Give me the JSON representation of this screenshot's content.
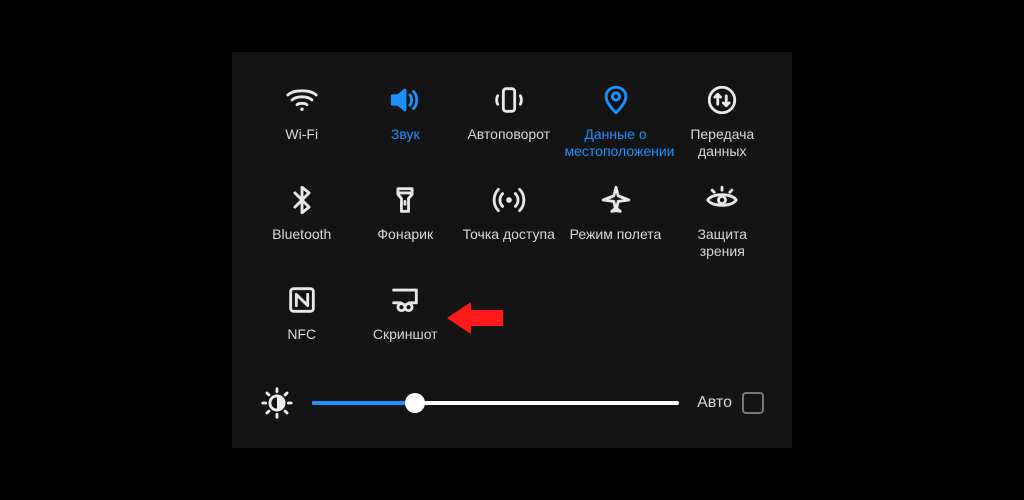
{
  "tiles": {
    "wifi": {
      "label": "Wi-Fi",
      "active": false
    },
    "sound": {
      "label": "Звук",
      "active": true
    },
    "rotate": {
      "label": "Автоповорот",
      "active": false
    },
    "location": {
      "label": "Данные о местоположении",
      "active": true
    },
    "data": {
      "label": "Передача данных",
      "active": false
    },
    "bluetooth": {
      "label": "Bluetooth",
      "active": false
    },
    "flashlight": {
      "label": "Фонарик",
      "active": false
    },
    "hotspot": {
      "label": "Точка доступа",
      "active": false
    },
    "airplane": {
      "label": "Режим полета",
      "active": false
    },
    "eyecare": {
      "label": "Защита зрения",
      "active": false
    },
    "nfc": {
      "label": "NFC",
      "active": false
    },
    "screenshot": {
      "label": "Скриншот",
      "active": false
    }
  },
  "brightness": {
    "value_percent": 28,
    "auto_label": "Авто",
    "auto_checked": false
  },
  "highlight_arrow_target": "screenshot"
}
